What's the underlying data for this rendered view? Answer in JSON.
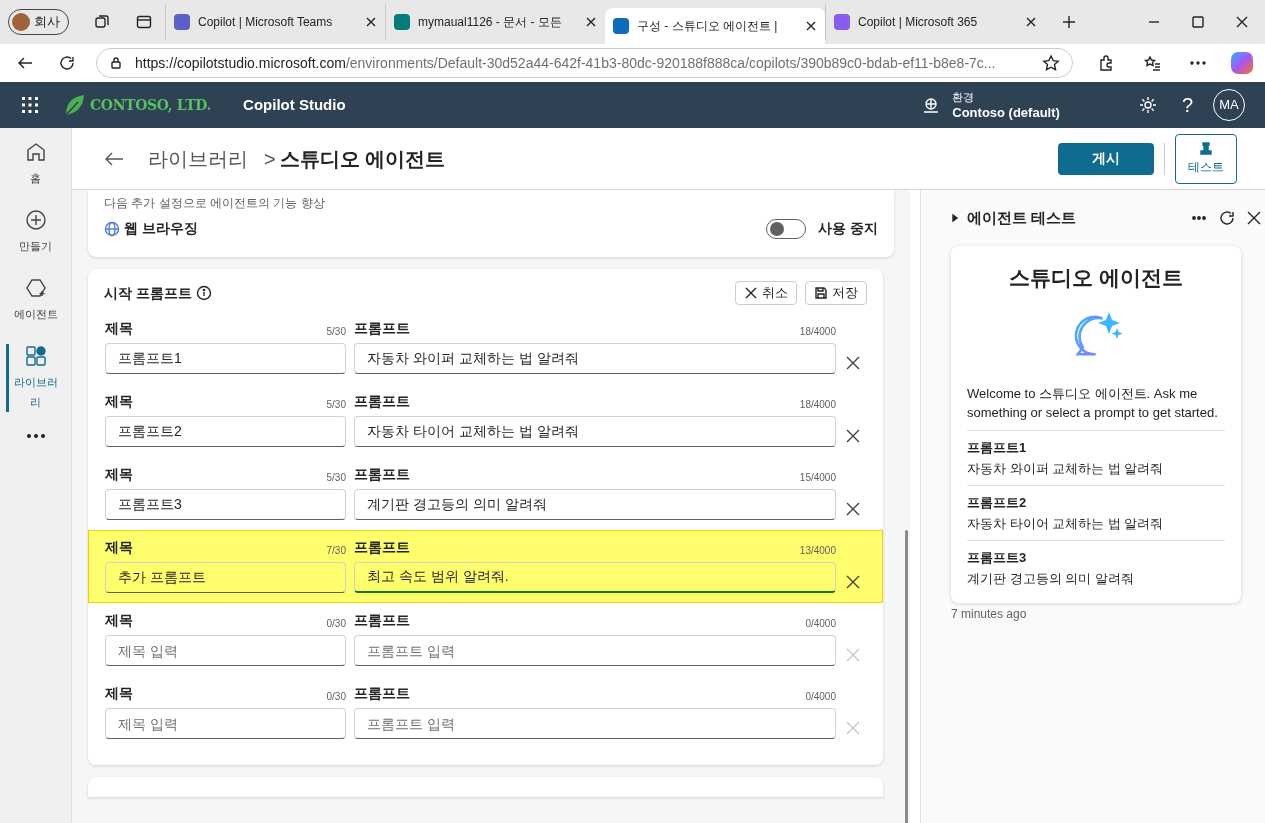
{
  "browser": {
    "profile": "회사",
    "tabs": [
      {
        "label": "Copilot | Microsoft Teams",
        "selected": false
      },
      {
        "label": "mymaual1126 - 문서 - 모든",
        "selected": false
      },
      {
        "label": "구성 - 스튜디오 에이전트 |",
        "selected": true
      },
      {
        "label": "Copilot | Microsoft 365",
        "selected": false
      }
    ],
    "url_host": "https://copilotstudio.microsoft.com",
    "url_path": "/environments/Default-30d52a44-642f-41b3-80dc-920188f888ca/copilots/390b89c0-bdab-ef11-b8e8-7c..."
  },
  "app_bar": {
    "brand": "CONTOSO, LTD.",
    "product": "Copilot Studio",
    "env_label": "환경",
    "env_value": "Contoso (default)",
    "help": "?",
    "avatar": "MA"
  },
  "rail": [
    {
      "label": "홈",
      "selected": false
    },
    {
      "label": "만들기",
      "selected": false
    },
    {
      "label": "에이전트",
      "selected": false
    },
    {
      "label": "라이브러리",
      "selected": true
    }
  ],
  "header": {
    "breadcrumb_parent": "라이브러리",
    "breadcrumb_sep": ">",
    "title": "스튜디오 에이전트",
    "publish": "게시",
    "test": "테스트"
  },
  "knowledge_card": {
    "subtitle": "다음 추가 설정으로 에이전트의 기능 향상",
    "feature": "웹 브라우징",
    "toggle_on": false,
    "toggle_label": "사용 중지"
  },
  "prompts_card": {
    "title": "시작 프롬프트",
    "cancel": "취소",
    "save": "저장",
    "rows": [
      {
        "title_label": "제목",
        "title_count": "5/30",
        "prompt_label": "프롬프트",
        "prompt_count": "18/4000",
        "title_value": "프롬프트1",
        "prompt_value": "자동차 와이퍼 교체하는 법 알려줘",
        "highlighted": false,
        "focused": false,
        "disabled": false
      },
      {
        "title_label": "제목",
        "title_count": "5/30",
        "prompt_label": "프롬프트",
        "prompt_count": "18/4000",
        "title_value": "프롬프트2",
        "prompt_value": "자동차 타이어 교체하는 법 알려줘",
        "highlighted": false,
        "focused": false,
        "disabled": false
      },
      {
        "title_label": "제목",
        "title_count": "5/30",
        "prompt_label": "프롬프트",
        "prompt_count": "15/4000",
        "title_value": "프롬프트3",
        "prompt_value": "계기판 경고등의 의미 알려줘",
        "highlighted": false,
        "focused": false,
        "disabled": false
      },
      {
        "title_label": "제목",
        "title_count": "7/30",
        "prompt_label": "프롬프트",
        "prompt_count": "13/4000",
        "title_value": "추가 프롬프트",
        "prompt_value": "최고 속도 범위 알려줘.",
        "highlighted": true,
        "focused": true,
        "disabled": false
      },
      {
        "title_label": "제목",
        "title_count": "0/30",
        "prompt_label": "프롬프트",
        "prompt_count": "0/4000",
        "title_placeholder": "제목 입력",
        "prompt_placeholder": "프롬프트 입력",
        "highlighted": false,
        "focused": false,
        "disabled": true
      },
      {
        "title_label": "제목",
        "title_count": "0/30",
        "prompt_label": "프롬프트",
        "prompt_count": "0/4000",
        "title_placeholder": "제목 입력",
        "prompt_placeholder": "프롬프트 입력",
        "highlighted": false,
        "focused": false,
        "disabled": true
      }
    ]
  },
  "test_panel": {
    "title": "에이전트 테스트",
    "card_title": "스튜디오 에이전트",
    "welcome": "Welcome to 스튜디오 에이전트. Ask me something or select a prompt to get started.",
    "prompts": [
      {
        "title": "프롬프트1",
        "text": "자동차 와이퍼 교체하는 법 알려줘"
      },
      {
        "title": "프롬프트2",
        "text": "자동차 타이어 교체하는 법 알려줘"
      },
      {
        "title": "프롬프트3",
        "text": "계기판 경고등의 의미 알려줘"
      }
    ],
    "timestamp": "7 minutes ago"
  }
}
